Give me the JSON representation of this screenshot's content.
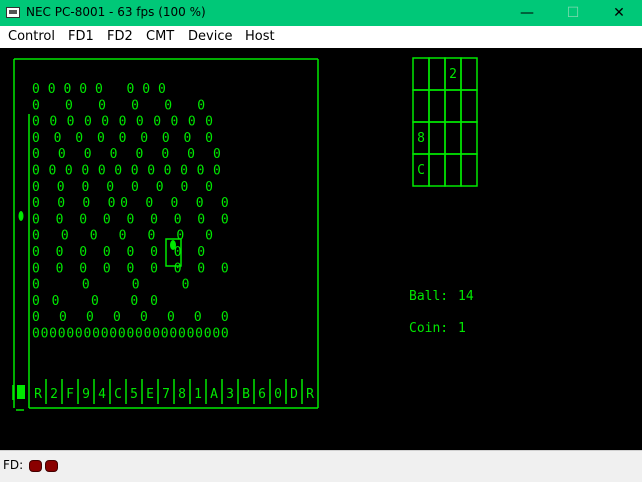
{
  "window": {
    "title": "NEC PC-8001 - 63 fps (100 %)",
    "minimize_glyph": "—",
    "maximize_glyph": "☐",
    "close_glyph": "✕",
    "app_icon": "pc-icon"
  },
  "menu": [
    "Control",
    "FD1",
    "FD2",
    "CMT",
    "Device",
    "Host"
  ],
  "colors": {
    "screen_fg": "#00e800",
    "screen_bg": "#000000",
    "titlebar": "#00c878",
    "led_off": "#8a0000"
  },
  "game": {
    "slot_labels": [
      "R",
      "2",
      "F",
      "9",
      "4",
      "C",
      "5",
      "E",
      "7",
      "8",
      "1",
      "A",
      "3",
      "B",
      "6",
      "0",
      "D",
      "R"
    ],
    "pin_rows": [
      "      00000   000",
      "   0  0  0     0  0  0",
      "  0 0 0 0 0 0 0 0 0 0 0",
      " 0 0 0 0  0    0 0 0  0",
      "  0  0  0  0  0  0  0  0",
      " 0 0 0 0 0 0 0 0 0 0 0 0",
      "  0  0  0  0 0   0 0  0",
      "   0  0  0  00 0  0  0  0",
      " 0  0  0  0 0  0  0  0  0",
      "    0  0  0  0  0  0  0",
      "  0  0  0 0 0  0  0  0",
      " 0  0  0  0 0  0  0  0  0",
      "    0     0     0  0",
      "     00   0   00",
      "  0  0  0   0  0  0  0  0",
      "  00000000000000000000000"
    ],
    "scoreboard": {
      "cells": [
        "",
        "",
        "2",
        "",
        "",
        "",
        "",
        "",
        "8",
        "",
        "",
        "",
        "C",
        "",
        "",
        ""
      ]
    },
    "ball_label": "Ball:",
    "ball_value": "14",
    "coin_label": "Coin:",
    "coin_value": "1"
  },
  "status": {
    "fd_label": "FD:"
  }
}
